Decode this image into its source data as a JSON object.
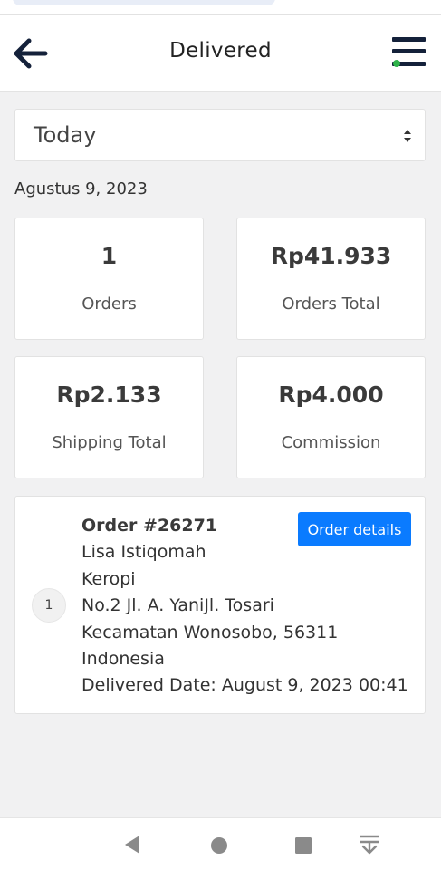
{
  "header": {
    "title": "Delivered",
    "back_icon": "arrow-left-icon",
    "menu_icon": "hamburger-menu-icon",
    "status_dot_color": "#2eb34a"
  },
  "filter": {
    "selected": "Today",
    "arrow_icon": "sort-arrows-icon"
  },
  "date_label": "Agustus 9, 2023",
  "stats": [
    {
      "value": "1",
      "label": "Orders"
    },
    {
      "value": "Rp41.933",
      "label": "Orders Total"
    },
    {
      "value": "Rp2.133",
      "label": "Shipping Total"
    },
    {
      "value": "Rp4.000",
      "label": "Commission"
    }
  ],
  "order": {
    "index": "1",
    "number": "Order #26271",
    "customer": "Lisa Istiqomah",
    "line1": "Keropi",
    "line2": "No.2 Jl. A. YaniJl. Tosari",
    "line3": "Kecamatan Wonosobo, 56311",
    "country": "Indonesia",
    "delivered": "Delivered Date: August 9, 2023 00:41",
    "details_label": "Order details",
    "accent": "#0a7bff"
  },
  "navbar": {
    "back_icon": "triangle-back-icon",
    "home_icon": "circle-home-icon",
    "recents_icon": "square-recents-icon",
    "extra_icon": "download-tray-icon"
  }
}
